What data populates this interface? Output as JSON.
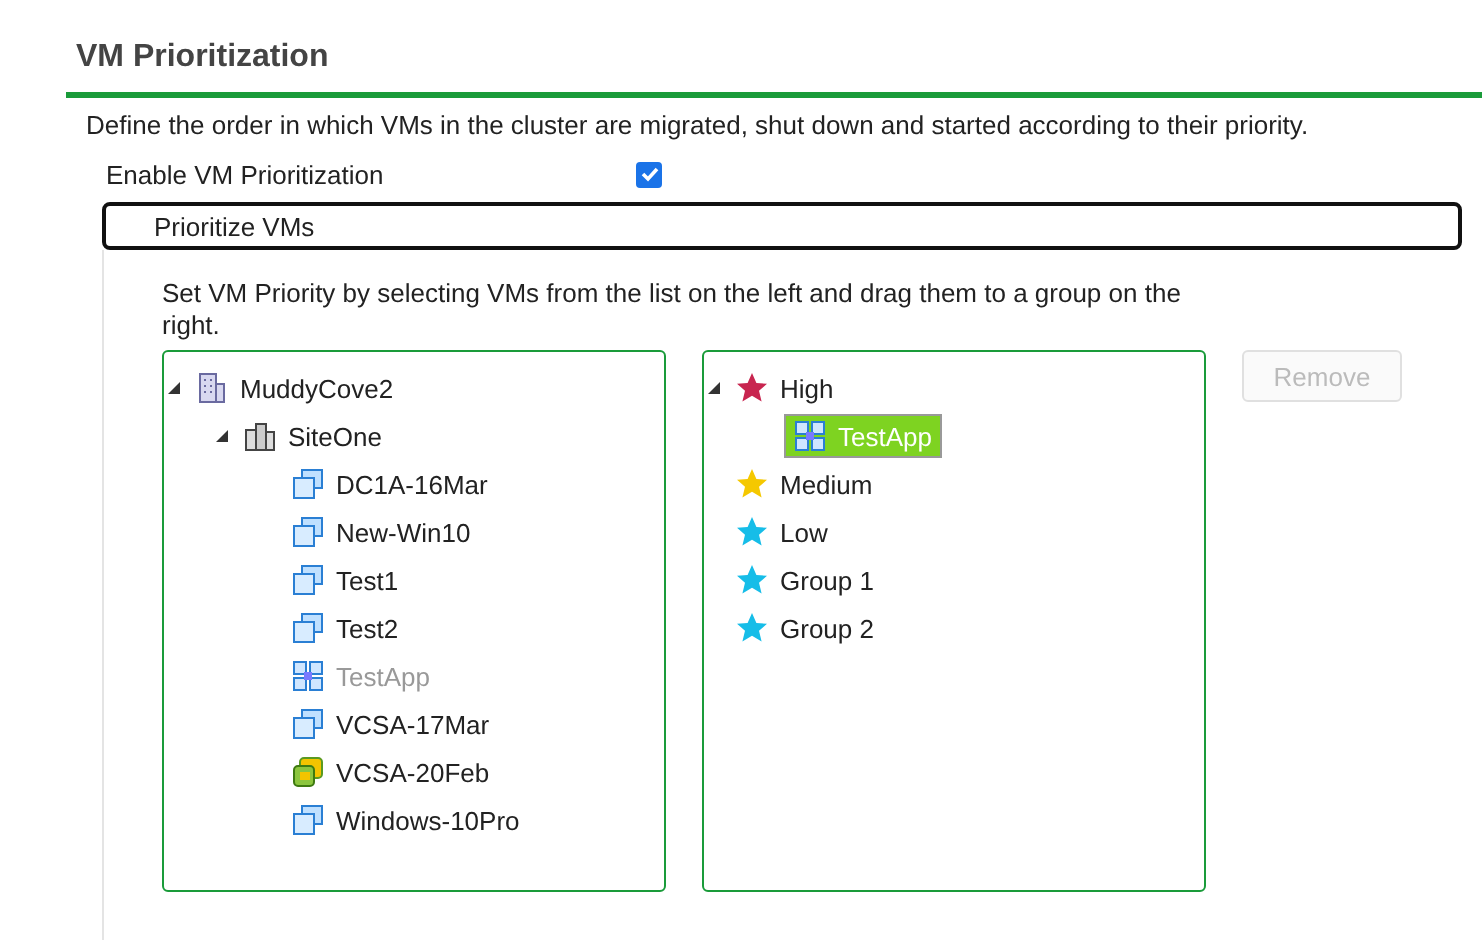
{
  "section": {
    "title": "VM Prioritization",
    "description": "Define the order in which VMs in the cluster are migrated, shut down and started according to their priority."
  },
  "enable": {
    "label": "Enable VM Prioritization",
    "checked": true
  },
  "panel": {
    "title": "Prioritize VMs",
    "instructions": "Set VM Priority by selecting VMs from the list on the left and drag them to a group on the right."
  },
  "vm_tree": [
    {
      "label": "MuddyCove2",
      "kind": "datacenter",
      "expanded": true,
      "children": [
        {
          "label": "SiteOne",
          "kind": "site",
          "expanded": true,
          "children": [
            {
              "label": "DC1A-16Mar",
              "kind": "vm",
              "disabled": false
            },
            {
              "label": "New-Win10",
              "kind": "vm",
              "disabled": false
            },
            {
              "label": "Test1",
              "kind": "vm",
              "disabled": false
            },
            {
              "label": "Test2",
              "kind": "vm",
              "disabled": false
            },
            {
              "label": "TestApp",
              "kind": "app",
              "disabled": true
            },
            {
              "label": "VCSA-17Mar",
              "kind": "vm",
              "disabled": false
            },
            {
              "label": "VCSA-20Feb",
              "kind": "vcsa",
              "disabled": false
            },
            {
              "label": "Windows-10Pro",
              "kind": "vm",
              "disabled": false
            }
          ]
        }
      ]
    }
  ],
  "group_tree": [
    {
      "label": "High",
      "kind": "group",
      "color": "#c8254f",
      "expanded": true,
      "children": [
        {
          "label": "TestApp",
          "kind": "app",
          "selected": true
        }
      ]
    },
    {
      "label": "Medium",
      "kind": "group",
      "color": "#f5c800"
    },
    {
      "label": "Low",
      "kind": "group",
      "color": "#16bde8"
    },
    {
      "label": "Group 1",
      "kind": "group",
      "color": "#16bde8"
    },
    {
      "label": "Group 2",
      "kind": "group",
      "color": "#16bde8"
    }
  ],
  "remove_button": {
    "label": "Remove",
    "disabled": true
  }
}
